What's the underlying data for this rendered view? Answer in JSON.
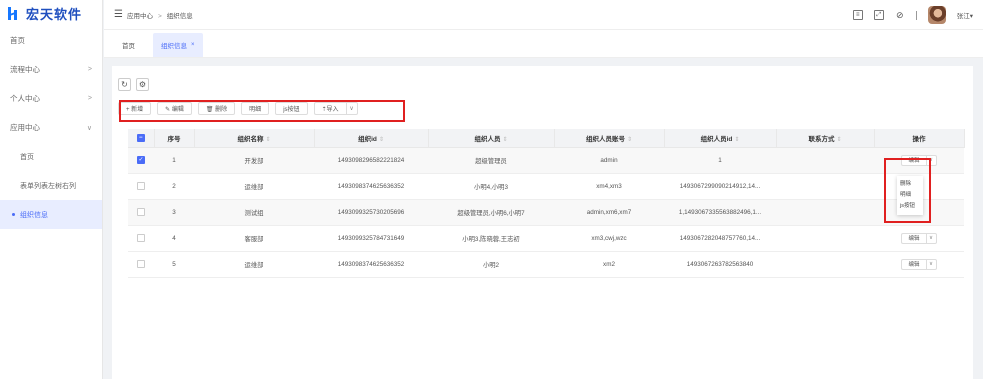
{
  "app": {
    "title": "宏天软件"
  },
  "sidebar": {
    "items": [
      {
        "label": "首页",
        "expandable": false
      },
      {
        "label": "流程中心",
        "expandable": true,
        "chevron": ">"
      },
      {
        "label": "个人中心",
        "expandable": true,
        "chevron": ">"
      },
      {
        "label": "应用中心",
        "expandable": true,
        "chevron": "∨"
      }
    ],
    "subitems": [
      {
        "label": "首页",
        "active": false
      },
      {
        "label": "表单列表左树右列",
        "active": false
      },
      {
        "label": "组织信息",
        "active": true
      }
    ]
  },
  "header": {
    "breadcrumb": [
      "应用中心",
      "组织信息"
    ],
    "breadcrumb_sep": ">",
    "user_name": "张江▾"
  },
  "tabs": [
    {
      "label": "首页",
      "active": false
    },
    {
      "label": "组织信息",
      "active": true,
      "close": "×"
    }
  ],
  "toolbar": {
    "add": "+ 新增",
    "edit": "✎ 编辑",
    "delete": "🗑 删除",
    "detail": "明细",
    "js_button": "js按钮",
    "import": "⇡导入",
    "import_caret": "∨"
  },
  "table": {
    "columns": [
      {
        "label": "序号",
        "sortable": false
      },
      {
        "label": "组织名称",
        "sortable": true
      },
      {
        "label": "组织id",
        "sortable": true
      },
      {
        "label": "组织人员",
        "sortable": true
      },
      {
        "label": "组织人员账号",
        "sortable": true
      },
      {
        "label": "组织人员id",
        "sortable": true
      },
      {
        "label": "联系方式",
        "sortable": true
      },
      {
        "label": "操作",
        "sortable": false
      }
    ],
    "sort_glyph": "⇕",
    "rows": [
      {
        "index": "1",
        "name": "开发部",
        "org_id": "1493098296582221824",
        "members": "超级管理员",
        "accounts": "admin",
        "member_ids": "1",
        "contact": "",
        "checked": true
      },
      {
        "index": "2",
        "name": "运维部",
        "org_id": "1493098374625636352",
        "members": "小明4,小明3",
        "accounts": "xm4,xm3",
        "member_ids": "1493067299090214912,14...",
        "contact": "",
        "checked": false
      },
      {
        "index": "3",
        "name": "测试组",
        "org_id": "1493099325730205696",
        "members": "超级管理员,小明6,小明7",
        "accounts": "admin,xm6,xm7",
        "member_ids": "1,1493067335563882496,1...",
        "contact": "",
        "checked": false
      },
      {
        "index": "4",
        "name": "客服部",
        "org_id": "1493099325784731649",
        "members": "小明3,陈晓蓉,王志初",
        "accounts": "xm3,cwj,wzc",
        "member_ids": "1493067282048757760,14...",
        "contact": "",
        "checked": false
      },
      {
        "index": "5",
        "name": "运维部",
        "org_id": "1493098374625636352",
        "members": "小明2",
        "accounts": "xm2",
        "member_ids": "1493067263782563840",
        "contact": "",
        "checked": false
      }
    ],
    "op_edit": "编辑",
    "op_more": "∨"
  },
  "dropdown": {
    "items": [
      "删除",
      "明细",
      "js按钮"
    ]
  },
  "colors": {
    "accent": "#4a6cf7",
    "highlight": "#e02020",
    "brand": "#1677ff"
  }
}
